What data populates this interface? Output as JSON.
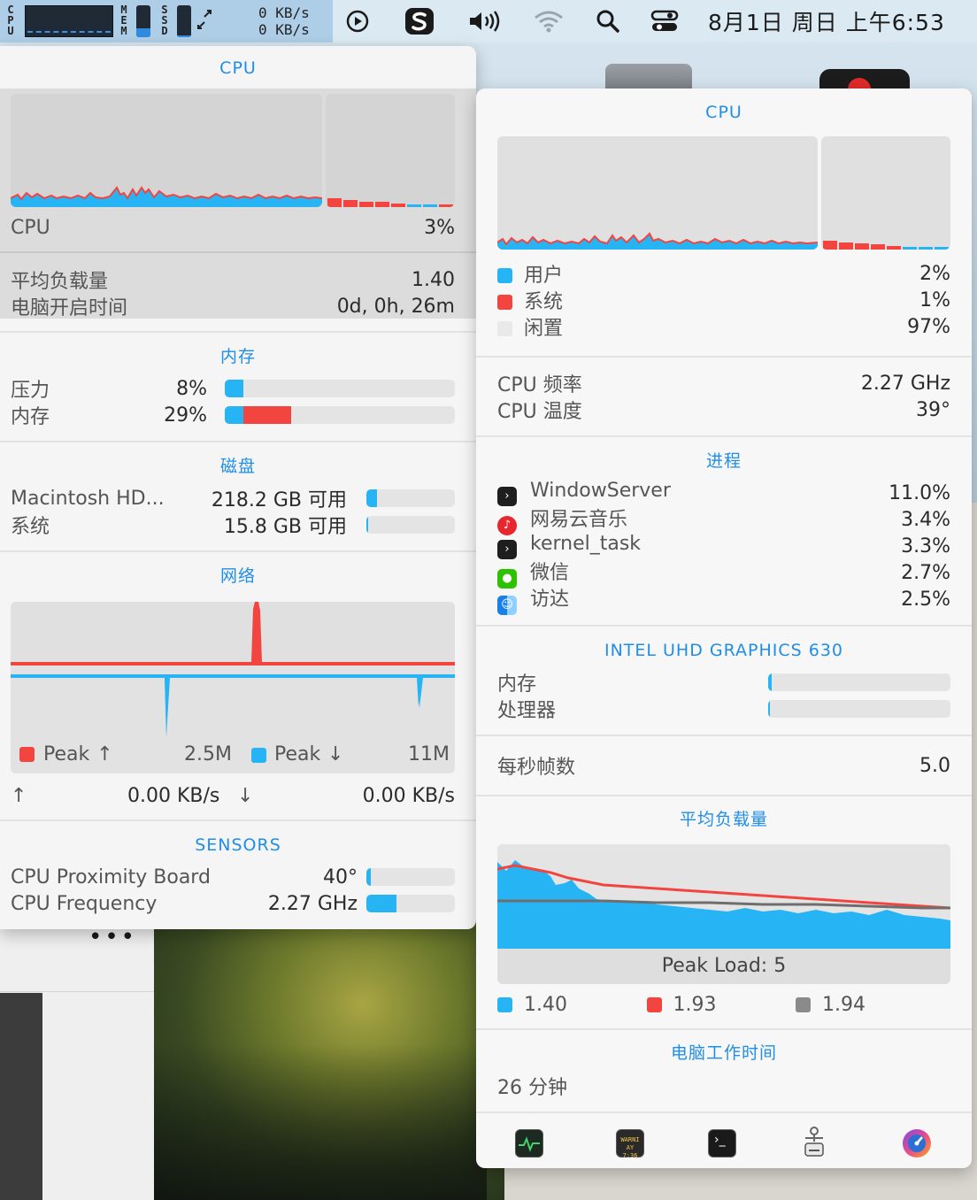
{
  "menubar": {
    "stats_labels": {
      "cpu": "CPU",
      "mem": "MEM",
      "ssd": "SSD"
    },
    "mem_fill": 0.29,
    "ssd_fill": 0.06,
    "net_up": "0 KB/s",
    "net_down": "0 KB/s",
    "clock": "8月1日 周日 上午6:53",
    "icons": [
      "play-circle-icon",
      "s-app-icon",
      "volume-icon",
      "wifi-icon",
      "search-icon",
      "control-center-icon"
    ]
  },
  "left": {
    "cpu": {
      "title": "CPU",
      "label": "CPU",
      "value": "3%",
      "load_label": "平均负载量",
      "load_value": "1.40",
      "uptime_label": "电脑开启时间",
      "uptime_value": "0d, 0h, 26m"
    },
    "memory": {
      "title": "内存",
      "pressure_label": "压力",
      "pressure_value": "8%",
      "pressure_fill": 0.08,
      "memory_label": "内存",
      "memory_value": "29%",
      "memory_fill_blue": 0.08,
      "memory_fill_red": 0.21
    },
    "disk": {
      "title": "磁盘",
      "disk1_label": "Macintosh HD...",
      "disk1_value": "218.2 GB 可用",
      "disk1_fill": 0.12,
      "disk2_label": "系统",
      "disk2_value": "15.8 GB 可用",
      "disk2_fill": 0.02
    },
    "network": {
      "title": "网络",
      "peak_up_label": "Peak",
      "peak_up_value": "2.5M",
      "peak_down_label": "Peak",
      "peak_down_value": "11M",
      "up_speed": "0.00 KB/s",
      "down_speed": "0.00 KB/s"
    },
    "sensors": {
      "title": "SENSORS",
      "s1_label": "CPU Proximity Board",
      "s1_value": "40°",
      "s1_fill": 0.05,
      "s2_label": "CPU Frequency",
      "s2_value": "2.27 GHz",
      "s2_fill": 0.34
    }
  },
  "right": {
    "cpu": {
      "title": "CPU",
      "user_label": "用户",
      "user_value": "2%",
      "system_label": "系统",
      "system_value": "1%",
      "idle_label": "闲置",
      "idle_value": "97%",
      "freq_label": "CPU 频率",
      "freq_value": "2.27 GHz",
      "temp_label": "CPU 温度",
      "temp_value": "39°"
    },
    "processes": {
      "title": "进程",
      "items": [
        {
          "name": "WindowServer",
          "value": "11.0%",
          "icon": "terminal-app-icon"
        },
        {
          "name": "网易云音乐",
          "value": "3.4%",
          "icon": "netease-music-icon"
        },
        {
          "name": "kernel_task",
          "value": "3.3%",
          "icon": "terminal-app-icon"
        },
        {
          "name": "微信",
          "value": "2.7%",
          "icon": "wechat-icon"
        },
        {
          "name": "访达",
          "value": "2.5%",
          "icon": "finder-icon"
        }
      ]
    },
    "gpu": {
      "title": "INTEL UHD GRAPHICS 630",
      "memory_label": "内存",
      "memory_fill": 0.02,
      "processor_label": "处理器",
      "processor_fill": 0.01,
      "fps_label": "每秒帧数",
      "fps_value": "5.0"
    },
    "load": {
      "title": "平均负载量",
      "peak_label": "Peak Load: 5",
      "legend": [
        "1.40",
        "1.93",
        "1.94"
      ]
    },
    "uptime": {
      "title": "电脑工作时间",
      "value": "26 分钟"
    },
    "dock_icons": [
      "activity-monitor-icon",
      "console-icon",
      "terminal-icon",
      "system-information-icon",
      "disk-utility-icon"
    ]
  },
  "colors": {
    "accent": "#1f8ee8",
    "blue": "#27b4f5",
    "red": "#f24540",
    "gray": "#8a8a8a"
  }
}
